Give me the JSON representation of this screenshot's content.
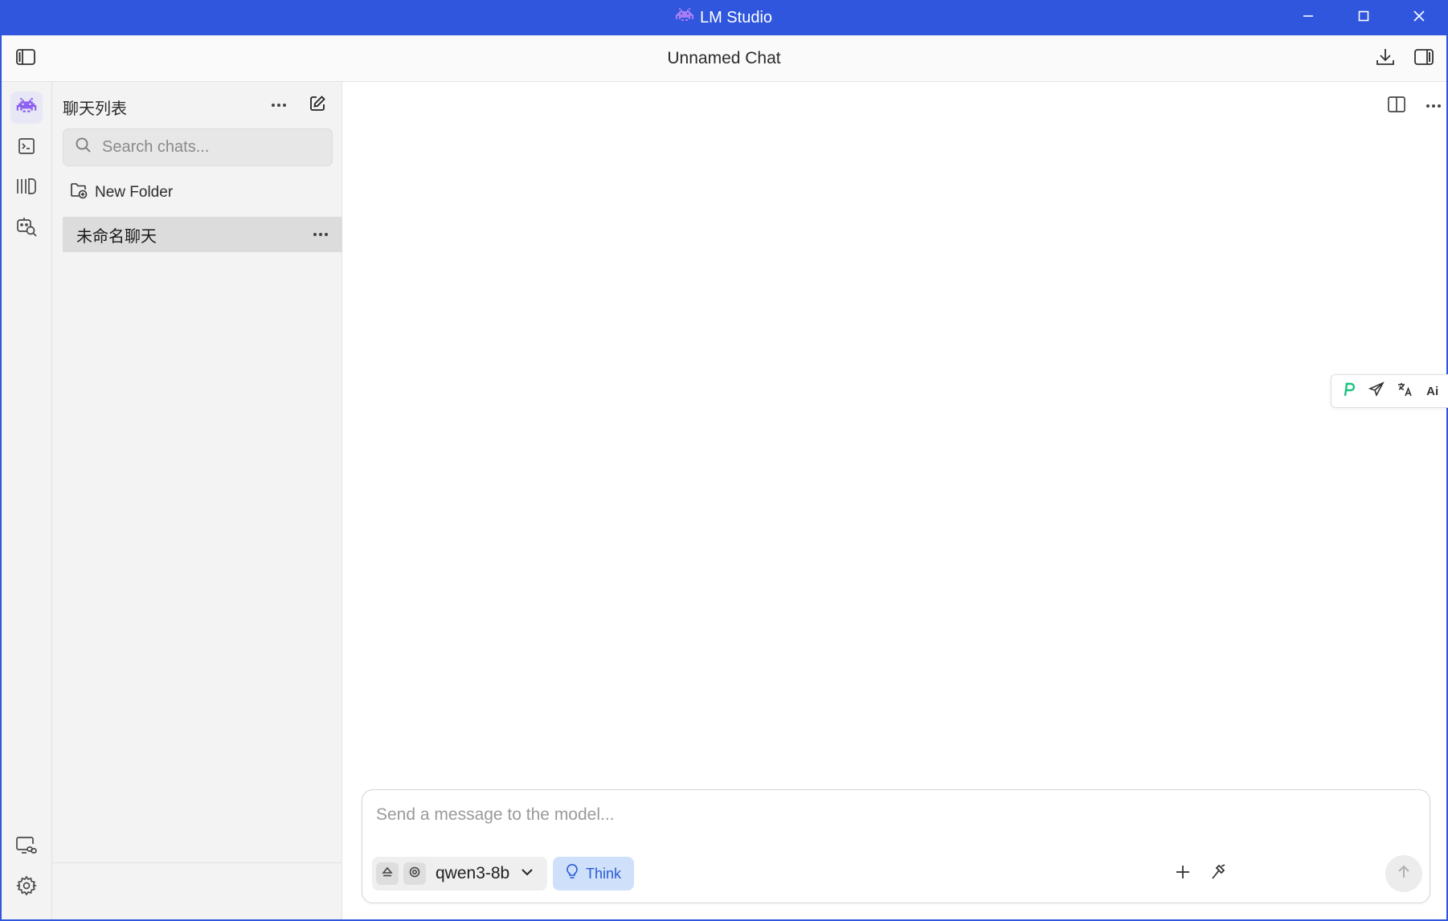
{
  "titlebar": {
    "title": "LM Studio",
    "icon": "lm-studio-invader-icon",
    "controls": [
      "minimize-icon",
      "maximize-icon",
      "close-icon"
    ]
  },
  "header": {
    "chat_title": "Unnamed Chat",
    "left_icon": "toggle-sidebar-icon",
    "right_icons": [
      "download-icon",
      "toggle-right-panel-icon"
    ]
  },
  "rail": {
    "items": [
      {
        "name": "chat",
        "icon": "invader-chat-icon",
        "active": true
      },
      {
        "name": "developer",
        "icon": "terminal-icon",
        "active": false
      },
      {
        "name": "my-models",
        "icon": "library-icon",
        "active": false
      },
      {
        "name": "discover",
        "icon": "robot-search-icon",
        "active": false
      }
    ],
    "bottom_items": [
      {
        "name": "link-device",
        "icon": "device-link-icon"
      },
      {
        "name": "settings",
        "icon": "gear-icon"
      }
    ]
  },
  "chatlist": {
    "title": "聊天列表",
    "search_placeholder": "Search chats...",
    "new_folder_label": "New Folder",
    "chats": [
      {
        "title": "未命名聊天",
        "selected": true
      }
    ]
  },
  "floating_toolbar": {
    "items": [
      "p-logo-icon",
      "send-plane-icon",
      "translate-icon"
    ],
    "ai_label": "Ai"
  },
  "composer": {
    "placeholder": "Send a message to the model...",
    "model_name": "qwen3-8b",
    "think_label": "Think"
  },
  "colors": {
    "titlebar": "#2f56dd",
    "accent_purple": "#8a5cf0",
    "think_bg": "#cfe0fb",
    "think_text": "#2a5bd3"
  }
}
